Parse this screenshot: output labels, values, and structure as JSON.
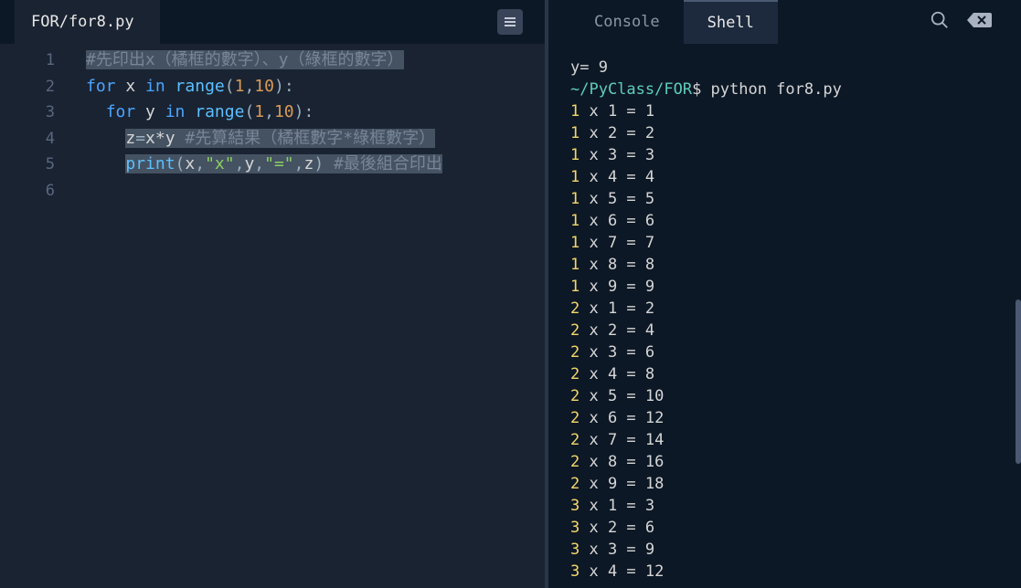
{
  "header": {
    "filename": "FOR/for8.py"
  },
  "code": {
    "lines": [
      "1",
      "2",
      "3",
      "4",
      "5",
      "6"
    ],
    "l1_comment": "#先印出x（橘框的數字）、y（綠框的數字）",
    "l2_for": "for",
    "l2_x": " x ",
    "l2_in": "in",
    "l2_range": " range",
    "l2_paren_o": "(",
    "l2_n1": "1",
    "l2_comma": ",",
    "l2_n2": "10",
    "l2_paren_c": ")",
    "l2_colon": ":",
    "l3_indent": "  ",
    "l3_for": "for",
    "l3_y": " y ",
    "l3_in": "in",
    "l3_range": " range",
    "l3_paren_o": "(",
    "l3_n1": "1",
    "l3_comma": ",",
    "l3_n2": "10",
    "l3_paren_c": ")",
    "l3_colon": ":",
    "l4_indent": "    ",
    "l4_z": "z",
    "l4_eq": "=",
    "l4_xy": "x*y ",
    "l4_comment": "#先算結果（橘框數字*綠框數字）",
    "l5_indent": "    ",
    "l5_print": "print",
    "l5_paren_o": "(",
    "l5_x": "x",
    "l5_c1": ",",
    "l5_s1": "\"x\"",
    "l5_c2": ",",
    "l5_y": "y",
    "l5_c3": ",",
    "l5_s2": "\"=\"",
    "l5_c4": ",",
    "l5_z": "z",
    "l5_paren_c": ") ",
    "l5_comment": "#最後組合印出"
  },
  "terminal": {
    "tabs": {
      "console": "Console",
      "shell": "Shell"
    },
    "first_line": "y= 9",
    "prompt_path": "~/PyClass/FOR",
    "prompt_cmd": "$ python for8.py",
    "output": [
      "1 x 1 = 1",
      "1 x 2 = 2",
      "1 x 3 = 3",
      "1 x 4 = 4",
      "1 x 5 = 5",
      "1 x 6 = 6",
      "1 x 7 = 7",
      "1 x 8 = 8",
      "1 x 9 = 9",
      "2 x 1 = 2",
      "2 x 2 = 4",
      "2 x 3 = 6",
      "2 x 4 = 8",
      "2 x 5 = 10",
      "2 x 6 = 12",
      "2 x 7 = 14",
      "2 x 8 = 16",
      "2 x 9 = 18",
      "3 x 1 = 3",
      "3 x 2 = 6",
      "3 x 3 = 9",
      "3 x 4 = 12"
    ]
  }
}
